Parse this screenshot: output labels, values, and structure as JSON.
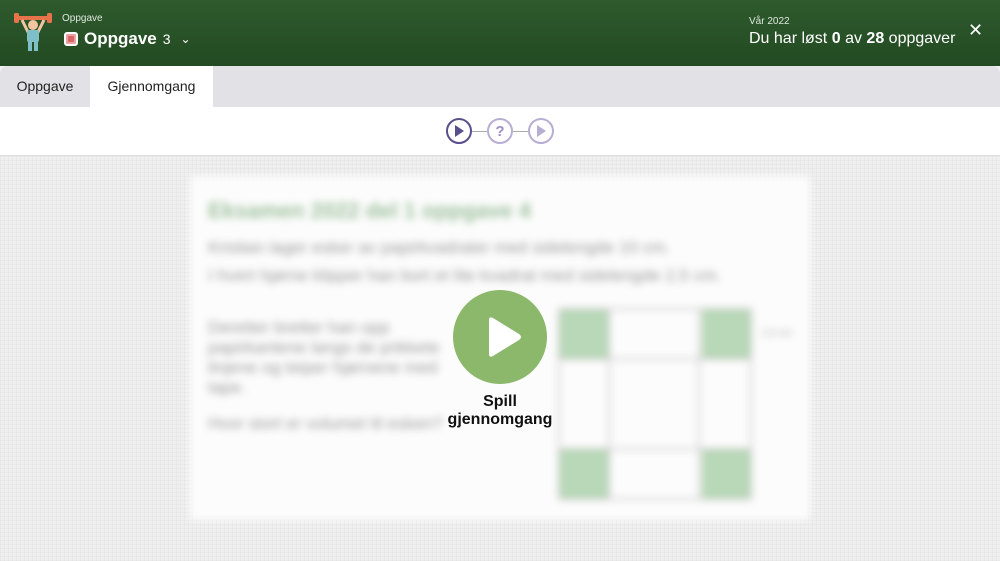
{
  "header": {
    "small_label": "Oppgave",
    "task_name": "Oppgave",
    "task_number": "3",
    "season": "Vår 2022",
    "progress_prefix": "Du har løst",
    "solved": "0",
    "progress_mid": "av",
    "total": "28",
    "progress_suffix": "oppgaver",
    "close_label": "✕",
    "chevron": "⌄"
  },
  "tabs": [
    {
      "label": "Oppgave"
    },
    {
      "label": "Gjennomgang"
    }
  ],
  "stepper": {
    "question_mark": "?"
  },
  "blurred_content": {
    "title": "Eksamen 2022 del 1 oppgave 4",
    "paragraphs": [
      "Kristian lager esker av papirkvadrater med sidelengde 10 cm.",
      "I hvert hjørne klipper han bort et lite kvadrat med sidelengde 2,5 cm.",
      "Deretter bretter han opp papirkantene langs de prikkete linjene og teiper hjørnene med tape.",
      "Hvor stort er volumet til esken?"
    ],
    "figure_label": "2,5 cm"
  },
  "overlay": {
    "play_label": "Spill gjennomgang"
  },
  "colors": {
    "header_green": "#2e5a2d",
    "play_green": "#8bb86a",
    "stepper_purple": "#5a4f8c"
  }
}
